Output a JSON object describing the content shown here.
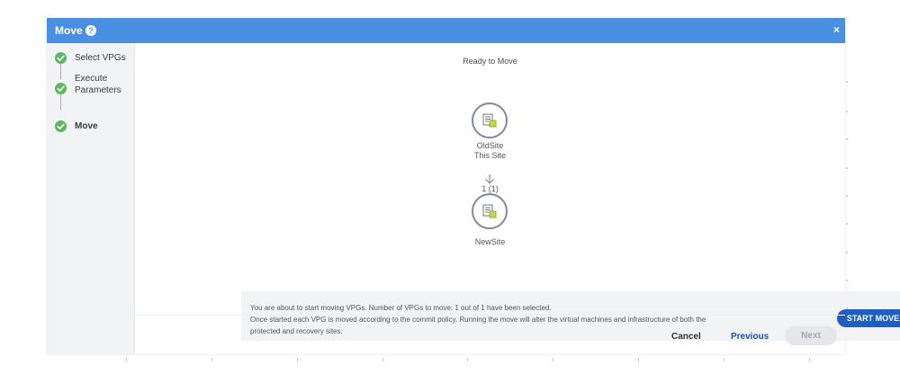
{
  "dialog": {
    "title": "Move",
    "help_icon": "help-circle-icon",
    "close_label": "×"
  },
  "steps": [
    {
      "label": "Select VPGs",
      "status": "complete"
    },
    {
      "label": "Execute",
      "label2": "Parameters",
      "status": "complete"
    },
    {
      "label": "Move",
      "status": "complete"
    }
  ],
  "main": {
    "status_text": "Ready to Move",
    "source_site": {
      "name": "OldSite",
      "subtitle": "This Site",
      "icon": "vpg-site-icon"
    },
    "vpg_count": "1 (1)",
    "target_site": {
      "name": "NewSite",
      "icon": "vpg-site-icon"
    }
  },
  "info": {
    "line1": "You are about to start moving VPGs. Number of VPGs to move: 1 out of 1 have been selected.",
    "line2": "Once started each VPG is moved according to the commit policy. Running the move will alter the virtual machines and infrastructure of both the",
    "line3": "protected and recovery sites.",
    "start_button": "START MOVE"
  },
  "footer": {
    "cancel": "Cancel",
    "previous": "Previous",
    "next": "Next"
  },
  "colors": {
    "titlebar": "#4a90e2",
    "check": "#5cb85c",
    "primary_button": "#1e5fbf",
    "disabled_button": "#e5e7ea"
  }
}
